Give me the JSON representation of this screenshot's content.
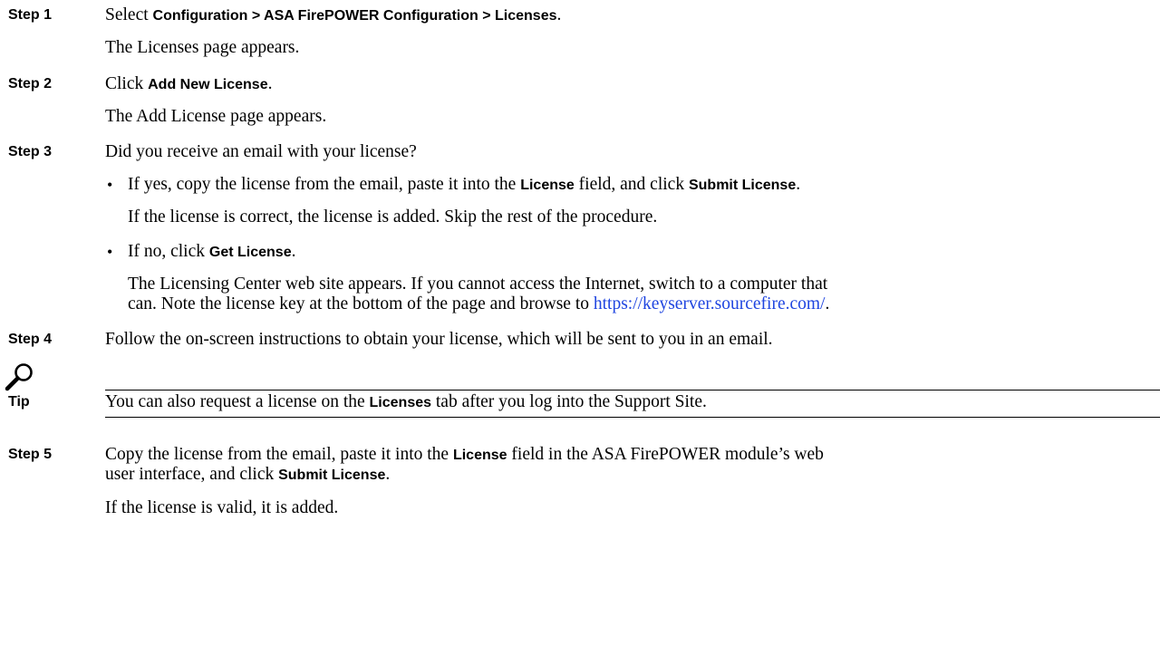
{
  "steps": [
    {
      "label": "Step 1",
      "text": {
        "before": "Select ",
        "ui": "Configuration > ASA FirePOWER Configuration > Licenses",
        "after": "."
      },
      "result": "The Licenses page appears."
    },
    {
      "label": "Step 2",
      "text": {
        "before": "Click ",
        "ui": "Add New License",
        "after": "."
      },
      "result": "The Add License page appears."
    },
    {
      "label": "Step 3",
      "text": "Did you receive an email with your license?",
      "bullets": [
        {
          "p1": "If yes, copy the license from the email, paste it into the ",
          "ui1": "License",
          "p2": " field, and click ",
          "ui2": "Submit License",
          "p3": ".",
          "note": "If the license is correct, the license is added. Skip the rest of the procedure."
        },
        {
          "p1": "If no, click ",
          "ui1": "Get License",
          "p2": ".",
          "note_line1": "The Licensing Center web site appears. If you cannot access the Internet, switch to a computer that",
          "note_line2_before": "can. Note the license key at the bottom of the page and browse to ",
          "link": "https://keyserver.sourcefire.com/",
          "note_line2_after": "."
        }
      ]
    },
    {
      "label": "Step 4",
      "text": "Follow the on-screen instructions to obtain your license, which will be sent to you in an email."
    },
    {
      "label": "Step 5",
      "line1": {
        "before": "Copy the license from the email, paste it into the ",
        "ui": "License",
        "after": " field in the ASA FirePOWER module’s web"
      },
      "line2": {
        "before": "user interface, and click ",
        "ui": "Submit License",
        "after": "."
      },
      "result": "If the license is valid, it is added."
    }
  ],
  "tip": {
    "icon": "magnifier-icon",
    "label": "Tip",
    "before": "You can also request a license on the ",
    "ui": "Licenses",
    "after": " tab after you log into the Support Site."
  }
}
